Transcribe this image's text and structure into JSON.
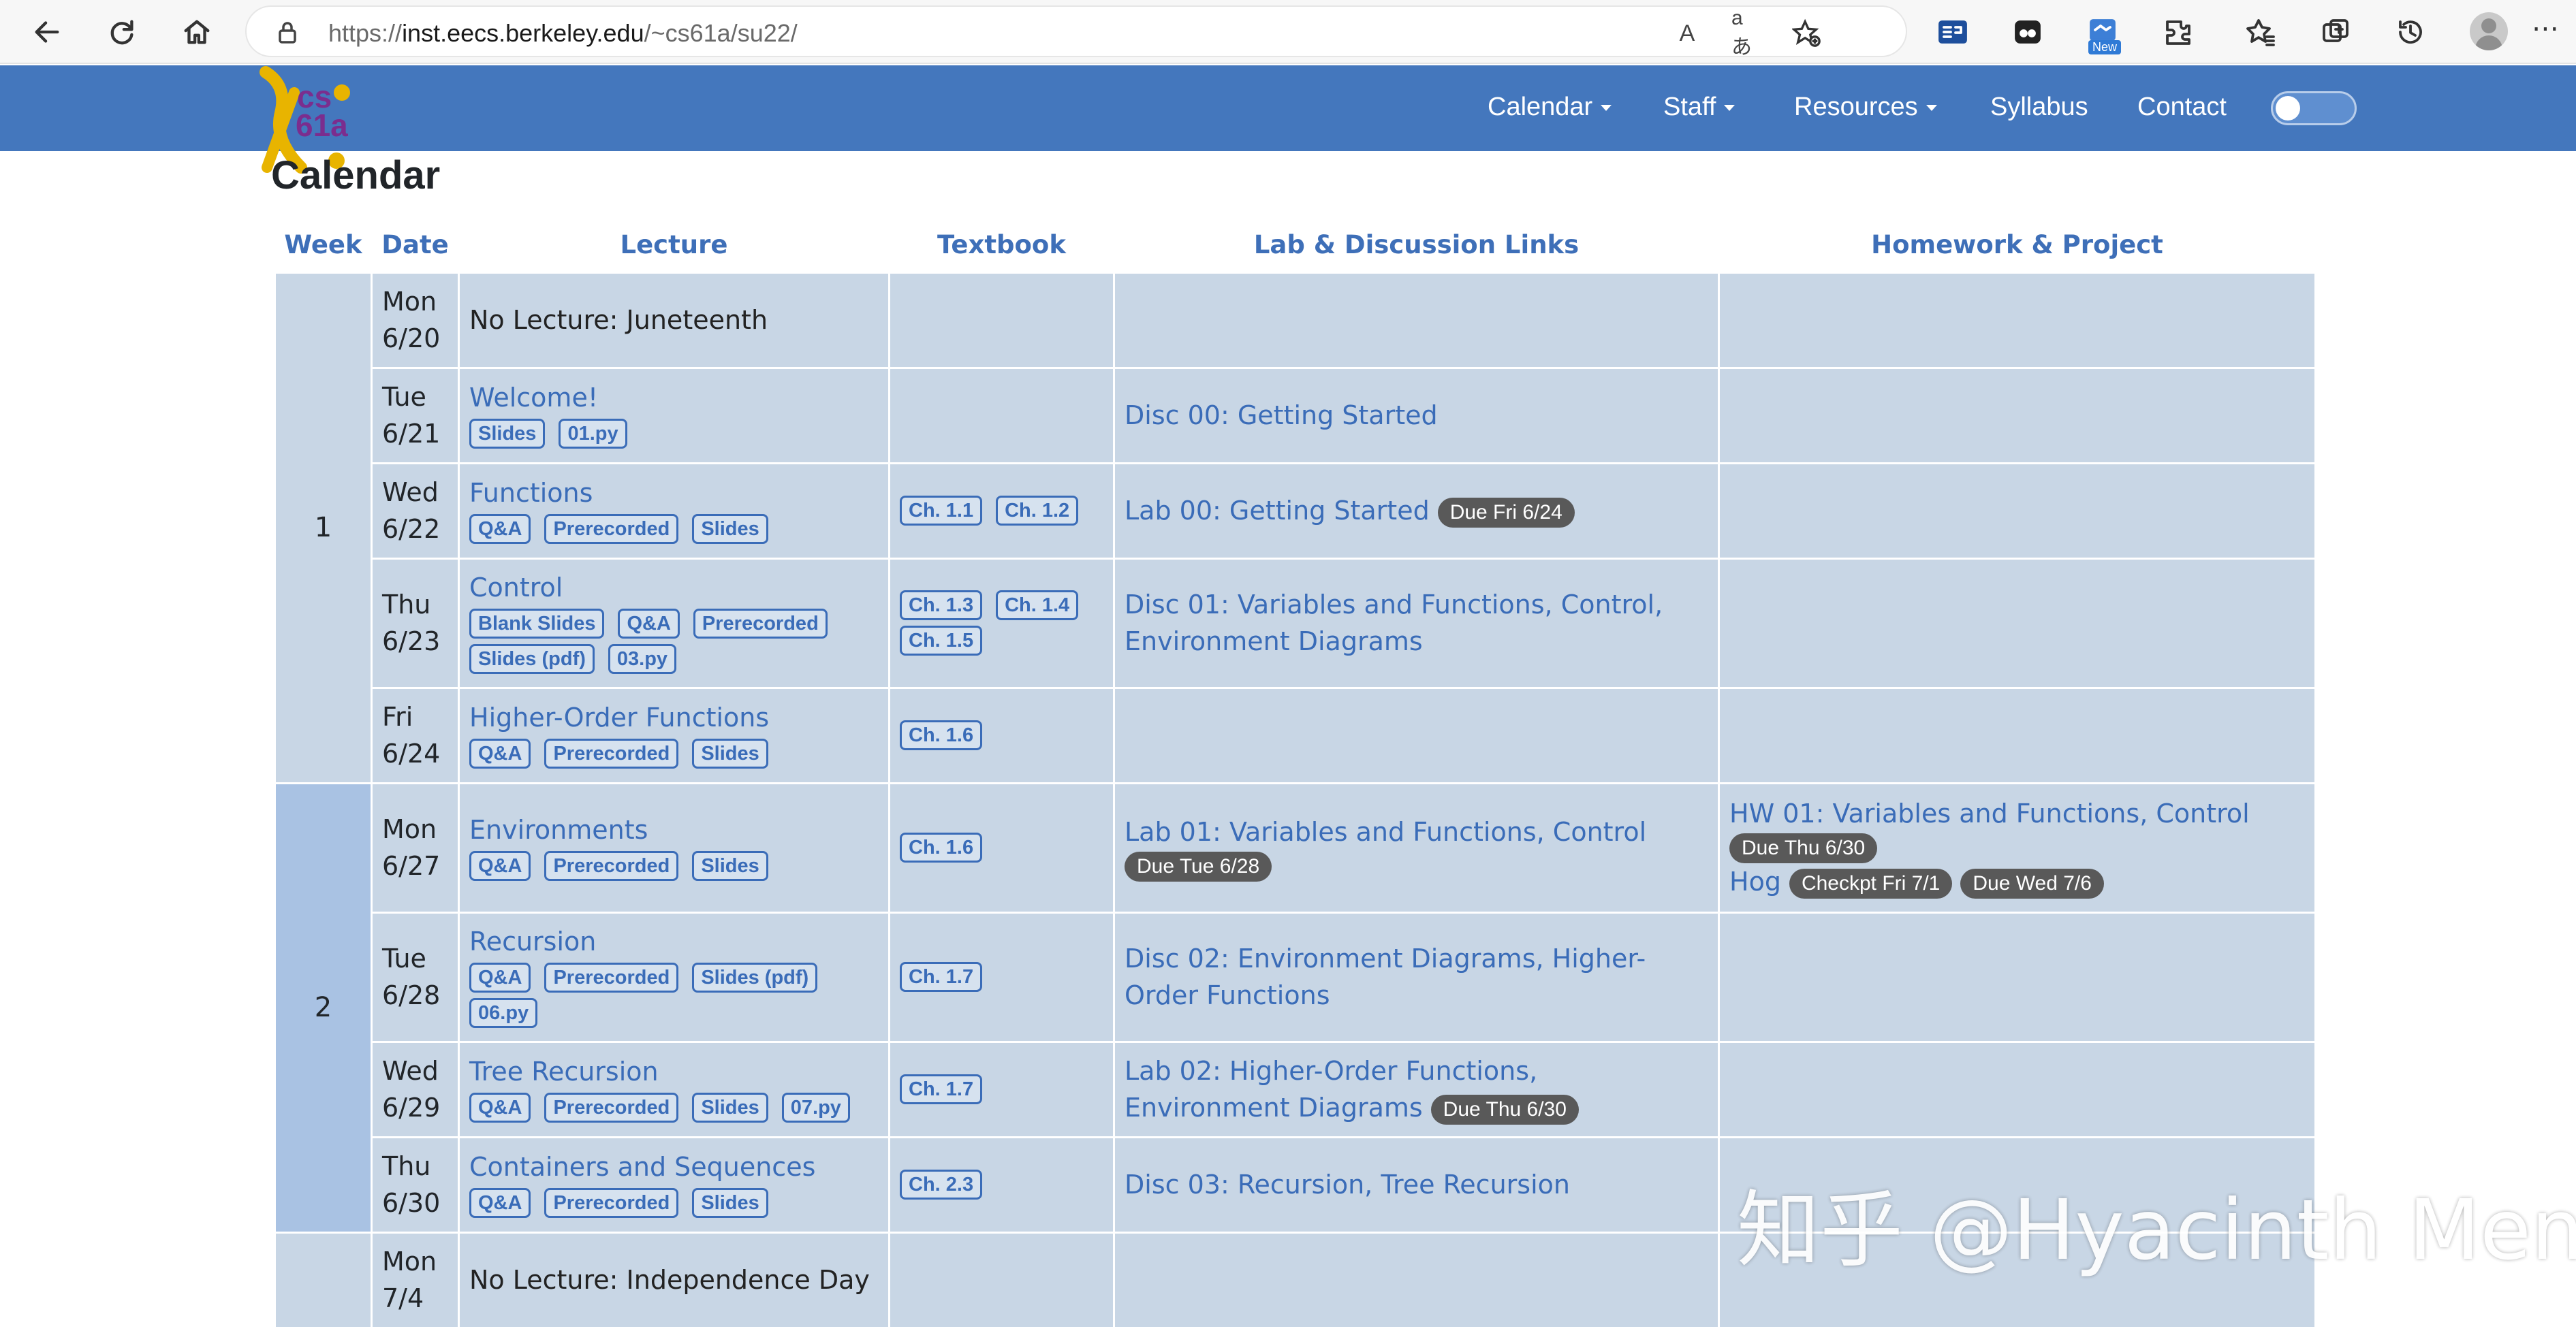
{
  "browser": {
    "url_prefix": "https://",
    "url_host": "inst.eecs.berkeley.edu",
    "url_path": "/~cs61a/su22/",
    "read_aloud_glyph": "A",
    "translate_glyph": "aあ",
    "new_badge": "New",
    "menu_glyph": "⋯"
  },
  "site": {
    "logo_text": "cs\n61a",
    "nav": {
      "calendar": "Calendar",
      "staff": "Staff",
      "resources": "Resources",
      "syllabus": "Syllabus",
      "contact": "Contact"
    },
    "colors": {
      "navbar": "#4477bd",
      "row": "#c8d6e5",
      "week_alt": "#a9c2e3",
      "link": "#3a6cb8"
    }
  },
  "calendar": {
    "title": "Calendar",
    "headers": [
      "Week",
      "Date",
      "Lecture",
      "Textbook",
      "Lab & Discussion Links",
      "Homework & Project"
    ],
    "weeks": [
      {
        "week": "1",
        "days": [
          {
            "dow": "Mon",
            "date": "6/20",
            "lecture": "No Lecture: Juneteenth",
            "lecture_is_link": false,
            "resources": [],
            "textbook": [],
            "lab": [],
            "hw": []
          },
          {
            "dow": "Tue",
            "date": "6/21",
            "lecture": "Welcome!",
            "lecture_is_link": true,
            "resources": [
              "Slides",
              "01.py"
            ],
            "textbook": [],
            "lab": [
              {
                "text": "Disc 00: Getting Started",
                "badges": []
              }
            ],
            "hw": []
          },
          {
            "dow": "Wed",
            "date": "6/22",
            "lecture": "Functions",
            "lecture_is_link": true,
            "resources": [
              "Q&A",
              "Prerecorded",
              "Slides"
            ],
            "textbook": [
              "Ch. 1.1",
              "Ch. 1.2"
            ],
            "lab": [
              {
                "text": "Lab 00: Getting Started",
                "badges": [
                  "Due Fri 6/24"
                ]
              }
            ],
            "hw": []
          },
          {
            "dow": "Thu",
            "date": "6/23",
            "lecture": "Control",
            "lecture_is_link": true,
            "resources": [
              "Blank Slides",
              "Q&A",
              "Prerecorded",
              "Slides (pdf)",
              "03.py"
            ],
            "textbook": [
              "Ch. 1.3",
              "Ch. 1.4",
              "Ch. 1.5"
            ],
            "lab": [
              {
                "text": "Disc 01: Variables and Functions, Control, Environment Diagrams",
                "badges": []
              }
            ],
            "hw": []
          },
          {
            "dow": "Fri",
            "date": "6/24",
            "lecture": "Higher-Order Functions",
            "lecture_is_link": true,
            "resources": [
              "Q&A",
              "Prerecorded",
              "Slides"
            ],
            "textbook": [
              "Ch. 1.6"
            ],
            "lab": [],
            "hw": []
          }
        ]
      },
      {
        "week": "2",
        "days": [
          {
            "dow": "Mon",
            "date": "6/27",
            "lecture": "Environments",
            "lecture_is_link": true,
            "resources": [
              "Q&A",
              "Prerecorded",
              "Slides"
            ],
            "textbook": [
              "Ch. 1.6"
            ],
            "lab": [
              {
                "text": "Lab 01: Variables and Functions, Control",
                "badges": [
                  "Due Tue 6/28"
                ],
                "badges_newline": true
              }
            ],
            "hw": [
              {
                "text": "HW 01: Variables and Functions, Control",
                "badges": [
                  "Due Thu 6/30"
                ],
                "badges_newline": true
              },
              {
                "text": "Hog",
                "badges": [
                  "Checkpt Fri 7/1",
                  "Due Wed 7/6"
                ]
              }
            ]
          },
          {
            "dow": "Tue",
            "date": "6/28",
            "lecture": "Recursion",
            "lecture_is_link": true,
            "resources": [
              "Q&A",
              "Prerecorded",
              "Slides (pdf)",
              "06.py"
            ],
            "textbook": [
              "Ch. 1.7"
            ],
            "lab": [
              {
                "text": "Disc 02: Environment Diagrams, Higher-Order Functions",
                "badges": []
              }
            ],
            "hw": []
          },
          {
            "dow": "Wed",
            "date": "6/29",
            "lecture": "Tree Recursion",
            "lecture_is_link": true,
            "resources": [
              "Q&A",
              "Prerecorded",
              "Slides",
              "07.py"
            ],
            "textbook": [
              "Ch. 1.7"
            ],
            "lab": [
              {
                "text": "Lab 02: Higher-Order Functions, Environment Diagrams",
                "badges": [
                  "Due Thu 6/30"
                ]
              }
            ],
            "hw": []
          },
          {
            "dow": "Thu",
            "date": "6/30",
            "lecture": "Containers and Sequences",
            "lecture_is_link": true,
            "resources": [
              "Q&A",
              "Prerecorded",
              "Slides"
            ],
            "textbook": [
              "Ch. 2.3"
            ],
            "lab": [
              {
                "text": "Disc 03: Recursion, Tree Recursion",
                "badges": []
              }
            ],
            "hw": []
          }
        ]
      },
      {
        "week": "",
        "days": [
          {
            "dow": "Mon",
            "date": "7/4",
            "lecture": "No Lecture: Independence Day",
            "lecture_is_link": false,
            "resources": [],
            "textbook": [],
            "lab": [],
            "hw": []
          }
        ]
      }
    ]
  },
  "watermark": "知乎 @Hyacinth Meng"
}
